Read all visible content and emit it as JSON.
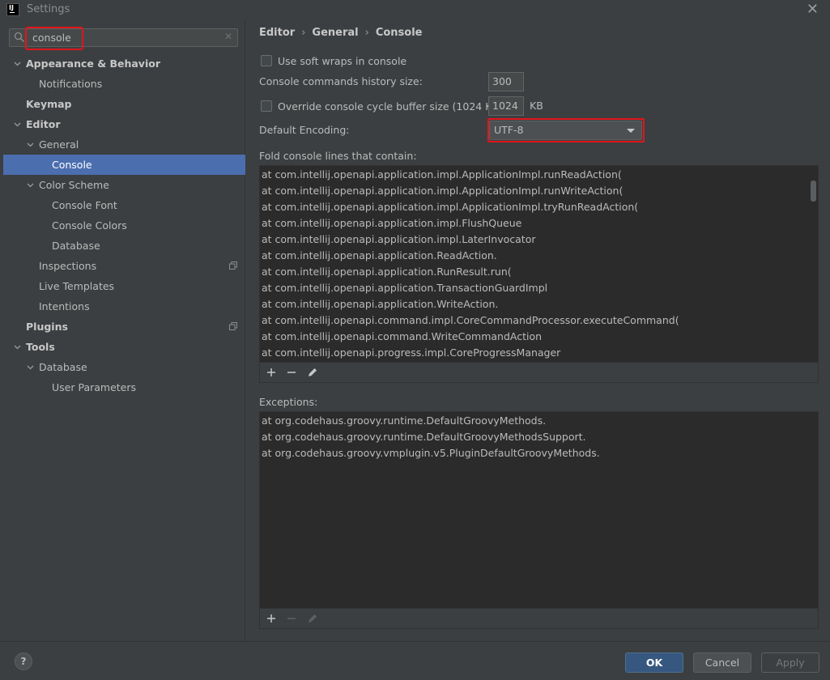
{
  "window": {
    "title": "Settings",
    "logo_text": "IJ"
  },
  "search": {
    "value": "console"
  },
  "tree": [
    {
      "label": "Appearance & Behavior",
      "bold": true,
      "arrow": "down"
    },
    {
      "label": "Notifications"
    },
    {
      "label": "Keymap",
      "bold": true
    },
    {
      "label": "Editor",
      "bold": true,
      "arrow": "down"
    },
    {
      "label": "General",
      "arrow": "down"
    },
    {
      "label": "Console",
      "selected": true
    },
    {
      "label": "Color Scheme",
      "arrow": "down"
    },
    {
      "label": "Console Font"
    },
    {
      "label": "Console Colors"
    },
    {
      "label": "Database"
    },
    {
      "label": "Inspections",
      "copy_icon": true
    },
    {
      "label": "Live Templates"
    },
    {
      "label": "Intentions"
    },
    {
      "label": "Plugins",
      "bold": true,
      "copy_icon": true
    },
    {
      "label": "Tools",
      "bold": true,
      "arrow": "down"
    },
    {
      "label": "Database",
      "arrow": "down"
    },
    {
      "label": "User Parameters"
    }
  ],
  "breadcrumb": [
    "Editor",
    "General",
    "Console"
  ],
  "settings": {
    "soft_wraps_label": "Use soft wraps in console",
    "history_label": "Console commands history size:",
    "history_value": "300",
    "override_label": "Override console cycle buffer size (1024 KB)",
    "buffer_value": "1024",
    "buffer_unit": "KB",
    "encoding_label": "Default Encoding:",
    "encoding_value": "UTF-8",
    "fold_label": "Fold console lines that contain:",
    "exceptions_label": "Exceptions:"
  },
  "fold_lines": [
    "at com.intellij.openapi.application.impl.ApplicationImpl.runReadAction(",
    "at com.intellij.openapi.application.impl.ApplicationImpl.runWriteAction(",
    "at com.intellij.openapi.application.impl.ApplicationImpl.tryRunReadAction(",
    "at com.intellij.openapi.application.impl.FlushQueue",
    "at com.intellij.openapi.application.impl.LaterInvocator",
    "at com.intellij.openapi.application.ReadAction.",
    "at com.intellij.openapi.application.RunResult.run(",
    "at com.intellij.openapi.application.TransactionGuardImpl",
    "at com.intellij.openapi.application.WriteAction.",
    "at com.intellij.openapi.command.impl.CoreCommandProcessor.executeCommand(",
    "at com.intellij.openapi.command.WriteCommandAction",
    "at com.intellij.openapi.progress.impl.CoreProgressManager"
  ],
  "exception_lines": [
    "at org.codehaus.groovy.runtime.DefaultGroovyMethods.",
    "at org.codehaus.groovy.runtime.DefaultGroovyMethodsSupport.",
    "at org.codehaus.groovy.vmplugin.v5.PluginDefaultGroovyMethods."
  ],
  "footer": {
    "ok": "OK",
    "cancel": "Cancel",
    "apply": "Apply",
    "help": "?"
  }
}
